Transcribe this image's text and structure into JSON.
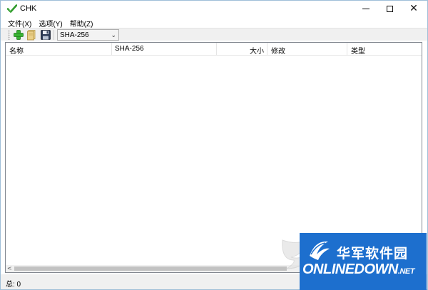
{
  "window": {
    "title": "CHK"
  },
  "menu": {
    "items": [
      "文件(X)",
      "选项(Y)",
      "帮助(Z)"
    ]
  },
  "toolbar": {
    "buttons": [
      {
        "name": "add",
        "icon": "plus-icon"
      },
      {
        "name": "open",
        "icon": "folder-icon"
      },
      {
        "name": "save",
        "icon": "floppy-icon"
      }
    ],
    "hash_select": {
      "value": "SHA-256"
    }
  },
  "list": {
    "columns": [
      "名称",
      "SHA-256",
      "大小",
      "修改",
      "类型"
    ],
    "rows": []
  },
  "status": {
    "text": "总: 0"
  },
  "watermark": {
    "cn": "华军软件园",
    "en": "ONLINEDOWN",
    "suffix": ".NET"
  },
  "colors": {
    "accent_green": "#2e9a2a",
    "watermark_blue": "#1d6fce"
  }
}
